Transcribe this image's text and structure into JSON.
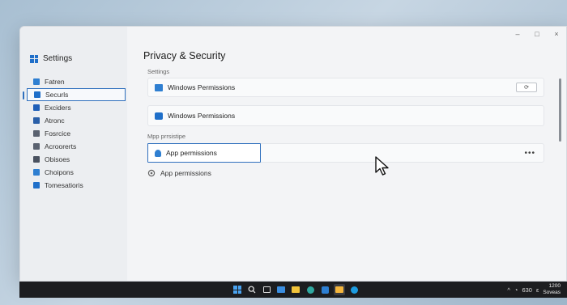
{
  "window": {
    "app_title": "Settings",
    "controls": {
      "minimize": "–",
      "maximize": "□",
      "close": "×"
    }
  },
  "sidebar": {
    "items": [
      {
        "label": "Fatren",
        "icon": "home-icon",
        "color": "#2f7fd1"
      },
      {
        "label": "Securls",
        "icon": "shield-icon",
        "color": "#1f6fc9",
        "selected": true
      },
      {
        "label": "Exciders",
        "icon": "grid-icon",
        "color": "#1f5fb8"
      },
      {
        "label": "Atronc",
        "icon": "grid-icon",
        "color": "#2a5fa8"
      },
      {
        "label": "Fosrcice",
        "icon": "apps-icon",
        "color": "#5a6270"
      },
      {
        "label": "Acroorerts",
        "icon": "accounts-icon",
        "color": "#5a6270"
      },
      {
        "label": "Obisoes",
        "icon": "time-icon",
        "color": "#4a5260"
      },
      {
        "label": "Choipons",
        "icon": "gaming-icon",
        "color": "#2f7fd1"
      },
      {
        "label": "Tomesatioris",
        "icon": "update-icon",
        "color": "#1f6fc9"
      }
    ]
  },
  "main": {
    "title": "Privacy & Security",
    "breadcrumb": "Settings",
    "card1": {
      "label": "Windows Permissions",
      "button": "⟳"
    },
    "card2": {
      "label": "Windows Permissions"
    },
    "subheading": "Mpp prrsistipe",
    "card3": {
      "label": "App permissions",
      "more": "•••"
    },
    "row4": {
      "label": "App permissions"
    }
  },
  "taskbar": {
    "tray_chevron": "^",
    "tray_value": "630",
    "tray_extra": "ε",
    "clock_time": "1200",
    "clock_date": "Soveas"
  },
  "colors": {
    "accent": "#2f6fbd",
    "taskbar": "#1c1d20",
    "window_bg": "#f3f4f6"
  }
}
